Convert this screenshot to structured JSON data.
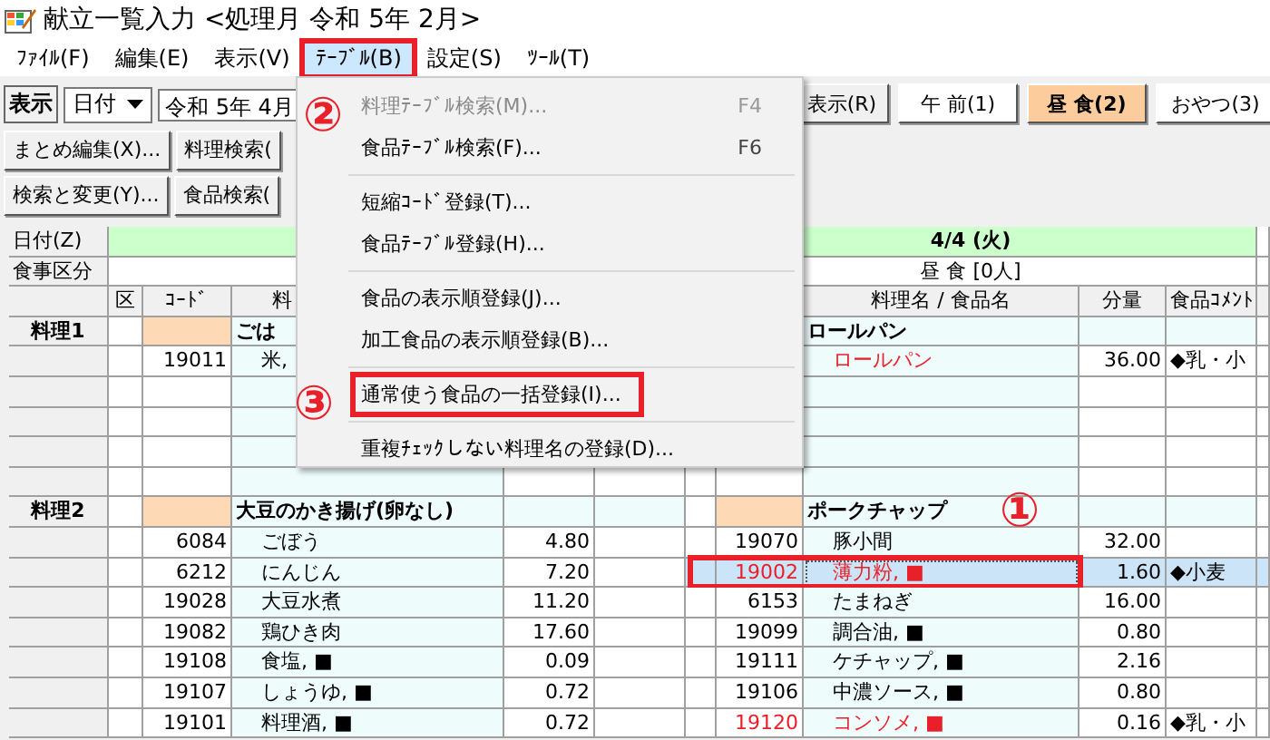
{
  "window": {
    "title": "献立一覧入力 <処理月 令和 5年 2月>"
  },
  "menubar": [
    {
      "label": "ﾌｧｲﾙ(F)",
      "selected": false,
      "marked": false
    },
    {
      "label": "編集(E)",
      "selected": false,
      "marked": false
    },
    {
      "label": "表示(V)",
      "selected": false,
      "marked": false
    },
    {
      "label": "ﾃｰﾌﾞﾙ(B)",
      "selected": true,
      "marked": true
    },
    {
      "label": "設定(S)",
      "selected": false,
      "marked": false
    },
    {
      "label": "ﾂｰﾙ(T)",
      "selected": false,
      "marked": false
    }
  ],
  "toolbar": {
    "view_label": "表示",
    "view_select": "日付",
    "date_field": "令和 5年 4月",
    "show_button": "表示(R)",
    "meals": [
      {
        "label": "午 前(1)",
        "selected": false
      },
      {
        "label": "昼 食(2)",
        "selected": true
      },
      {
        "label": "おやつ(3)",
        "selected": false
      }
    ],
    "row2": [
      "まとめ編集(X)...",
      "料理検索("
    ],
    "row3": [
      "検索と変更(Y)...",
      "食品検索("
    ]
  },
  "dropdown_menu": [
    {
      "kind": "item",
      "label": "料理ﾃｰﾌﾞﾙ検索(M)...",
      "shortcut": "F4",
      "disabled": true,
      "marked": false
    },
    {
      "kind": "item",
      "label": "食品ﾃｰﾌﾞﾙ検索(F)...",
      "shortcut": "F6",
      "disabled": false,
      "marked": false
    },
    {
      "kind": "separator"
    },
    {
      "kind": "item",
      "label": "短縮ｺｰﾄﾞ登録(T)...",
      "disabled": false,
      "marked": false
    },
    {
      "kind": "item",
      "label": "食品ﾃｰﾌﾞﾙ登録(H)...",
      "disabled": false,
      "marked": false
    },
    {
      "kind": "separator"
    },
    {
      "kind": "item",
      "label": "食品の表示順登録(J)...",
      "disabled": false,
      "marked": false
    },
    {
      "kind": "item",
      "label": "加工食品の表示順登録(B)...",
      "disabled": false,
      "marked": false
    },
    {
      "kind": "separator"
    },
    {
      "kind": "item",
      "label": "通常使う食品の一括登録(I)...",
      "disabled": false,
      "marked": true
    },
    {
      "kind": "separator"
    },
    {
      "kind": "item",
      "label": "重複ﾁｪｯｸしない料理名の登録(D)...",
      "disabled": false,
      "marked": false
    }
  ],
  "grid": {
    "date_label": "日付(Z)",
    "meal_label": "食事区分",
    "right_date": "4/4 (火)",
    "right_meal": "昼 食 [0人]",
    "left_columns": [
      "区",
      "ｺｰﾄﾞ",
      "料"
    ],
    "right_columns": [
      "料理名 / 食品名",
      "分量",
      "食品ｺﾒﾝﾄ"
    ],
    "left_rows": [
      {
        "kind": "dish",
        "label": "料理1",
        "name": "ごは"
      },
      {
        "kind": "food",
        "code": "19011",
        "name": "米,",
        "flagged": false
      },
      {
        "kind": "empty"
      },
      {
        "kind": "empty"
      },
      {
        "kind": "empty"
      },
      {
        "kind": "empty"
      },
      {
        "kind": "dish",
        "label": "料理2",
        "name": "大豆のかき揚げ(卵なし)"
      },
      {
        "kind": "food",
        "code": "6084",
        "name": "ごぼう",
        "amount": "4.80",
        "flagged": false
      },
      {
        "kind": "food",
        "code": "6212",
        "name": "にんじん",
        "amount": "7.20",
        "flagged": false
      },
      {
        "kind": "food",
        "code": "19028",
        "name": "大豆水煮",
        "amount": "11.20",
        "flagged": false
      },
      {
        "kind": "food",
        "code": "19082",
        "name": "鶏ひき肉",
        "amount": "17.60",
        "flagged": false
      },
      {
        "kind": "food",
        "code": "19108",
        "name": "食塩, ■",
        "amount": "0.09",
        "flagged": false
      },
      {
        "kind": "food",
        "code": "19107",
        "name": "しょうゆ, ■",
        "amount": "0.72",
        "flagged": false
      },
      {
        "kind": "food",
        "code": "19101",
        "name": "料理酒, ■",
        "amount": "0.72",
        "flagged": false
      }
    ],
    "right_rows": [
      {
        "kind": "dish",
        "name": "ロールパン"
      },
      {
        "kind": "food",
        "name": "ロールパン",
        "amount": "36.00",
        "comment": "◆乳・小",
        "flagged": true,
        "selected": false,
        "marked": false
      },
      {
        "kind": "empty"
      },
      {
        "kind": "empty"
      },
      {
        "kind": "empty"
      },
      {
        "kind": "empty"
      },
      {
        "kind": "dish",
        "name": "ポークチャップ"
      },
      {
        "kind": "food",
        "code": "19070",
        "name": "豚小間",
        "amount": "32.00",
        "flagged": false,
        "selected": false,
        "marked": false
      },
      {
        "kind": "food",
        "code": "19002",
        "name": "薄力粉, ■",
        "amount": "1.60",
        "comment": "◆小麦",
        "flagged": true,
        "selected": true,
        "marked": true
      },
      {
        "kind": "food",
        "code": "6153",
        "name": "たまねぎ",
        "amount": "16.00",
        "flagged": false,
        "selected": false,
        "marked": false
      },
      {
        "kind": "food",
        "code": "19099",
        "name": "調合油, ■",
        "amount": "0.80",
        "flagged": false,
        "selected": false,
        "marked": false
      },
      {
        "kind": "food",
        "code": "19111",
        "name": "ケチャップ, ■",
        "amount": "2.16",
        "flagged": false,
        "selected": false,
        "marked": false
      },
      {
        "kind": "food",
        "code": "19106",
        "name": "中濃ソース, ■",
        "amount": "0.80",
        "flagged": false,
        "selected": false,
        "marked": false
      },
      {
        "kind": "food",
        "code": "19120",
        "name": "コンソメ, ■",
        "amount": "0.16",
        "comment": "◆乳・小",
        "flagged": true,
        "selected": false,
        "marked": false
      }
    ]
  },
  "annotations": [
    "②",
    "③",
    "①"
  ]
}
